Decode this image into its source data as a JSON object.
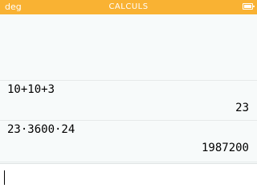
{
  "status_bar": {
    "angle_mode": "deg",
    "app_title": "CALCULS",
    "battery_level": 1.0,
    "battery_icon": "battery-icon",
    "color": "#f9b233"
  },
  "history": [
    {
      "input": "10+10+3",
      "output": "23"
    },
    {
      "input": "23·3600·24",
      "output": "1987200"
    }
  ],
  "editor": {
    "value": ""
  }
}
